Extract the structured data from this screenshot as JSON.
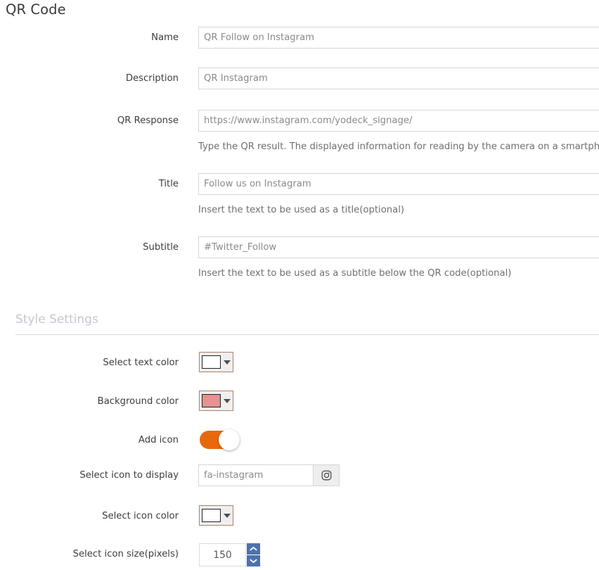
{
  "page": {
    "title": "QR Code"
  },
  "fields": {
    "name": {
      "label": "Name",
      "value": "QR Follow on Instagram",
      "placeholder": "QR Follow on Instagram"
    },
    "description": {
      "label": "Description",
      "value": "QR Instagram",
      "placeholder": "QR Instagram"
    },
    "qr_response": {
      "label": "QR Response",
      "value": "https://www.instagram.com/yodeck_signage/",
      "placeholder": "https://www.instagram.com/yodeck_signage/",
      "help": "Type the QR result. The displayed information for reading by the camera on a smartphone"
    },
    "title": {
      "label": "Title",
      "value": "Follow us on Instagram",
      "placeholder": "Follow us on Instagram",
      "help": "Insert the text to be used as a title(optional)"
    },
    "subtitle": {
      "label": "Subtitle",
      "value": "#Twitter_Follow",
      "placeholder": "#Twitter_Follow",
      "help": "Insert the text to be used as a subtitle below the QR code(optional)"
    }
  },
  "style_settings": {
    "heading": "Style Settings",
    "text_color": {
      "label": "Select text color",
      "swatch_hex": "#ffffff"
    },
    "background_color": {
      "label": "Background color",
      "swatch_hex": "#e79191"
    },
    "add_icon": {
      "label": "Add icon",
      "state": "on",
      "accent_hex": "#e8690d"
    },
    "icon_to_display": {
      "label": "Select icon to display",
      "value": "fa-instagram",
      "placeholder": "fa-instagram",
      "addon_icon": "instagram-icon"
    },
    "icon_color": {
      "label": "Select icon color",
      "swatch_hex": "#ffffff"
    },
    "icon_size": {
      "label": "Select icon size(pixels)",
      "value": "150",
      "spinner_accent_hex": "#4c72ac"
    }
  }
}
